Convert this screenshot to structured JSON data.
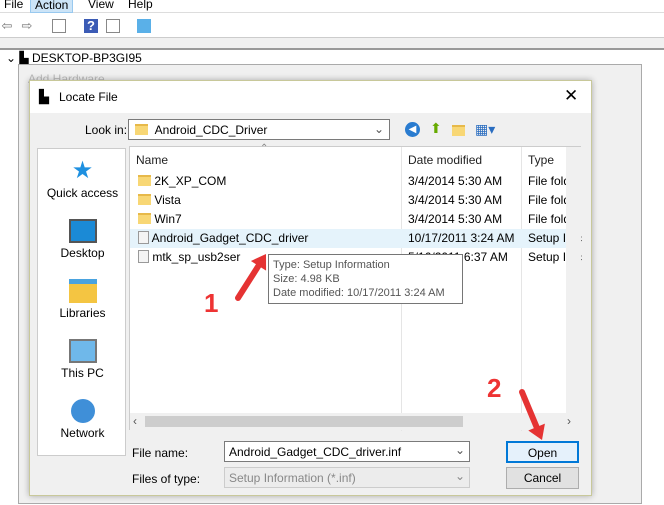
{
  "menubar": {
    "items": [
      "File",
      "Action",
      "View",
      "Help"
    ],
    "active": "Action"
  },
  "tree": {
    "root": "DESKTOP-BP3GI95"
  },
  "background_dialog": {
    "title": "Add Hardware"
  },
  "dialog": {
    "title": "Locate File",
    "look_in_label": "Look in:",
    "look_in_value": "Android_CDC_Driver",
    "sidebar": [
      {
        "label": "Quick access",
        "icon": "star-icon"
      },
      {
        "label": "Desktop",
        "icon": "desktop-icon"
      },
      {
        "label": "Libraries",
        "icon": "libraries-icon"
      },
      {
        "label": "This PC",
        "icon": "computer-icon"
      },
      {
        "label": "Network",
        "icon": "network-icon"
      }
    ],
    "columns": [
      "Name",
      "Date modified",
      "Type"
    ],
    "files": [
      {
        "name": "2K_XP_COM",
        "date": "3/4/2014 5:30 AM",
        "type": "File folder",
        "icon": "folder"
      },
      {
        "name": "Vista",
        "date": "3/4/2014 5:30 AM",
        "type": "File folder",
        "icon": "folder"
      },
      {
        "name": "Win7",
        "date": "3/4/2014 5:30 AM",
        "type": "File folder",
        "icon": "folder"
      },
      {
        "name": "Android_Gadget_CDC_driver",
        "date": "10/17/2011 3:24 AM",
        "type": "Setup Infc",
        "icon": "file"
      },
      {
        "name": "mtk_sp_usb2ser",
        "date": "5/16/2011 6:37 AM",
        "type": "Setup Infc",
        "icon": "file"
      }
    ],
    "tooltip": {
      "type": "Type: Setup Information",
      "size": "Size: 4.98 KB",
      "date": "Date modified: 10/17/2011 3:24 AM"
    },
    "file_name_label": "File name:",
    "file_name_value": "Android_Gadget_CDC_driver.inf",
    "file_type_label": "Files of type:",
    "file_type_value": "Setup Information (*.inf)",
    "open_label": "Open",
    "cancel_label": "Cancel"
  },
  "annotations": {
    "step1": "1",
    "step2": "2",
    "arrow_color": "#e53333"
  }
}
